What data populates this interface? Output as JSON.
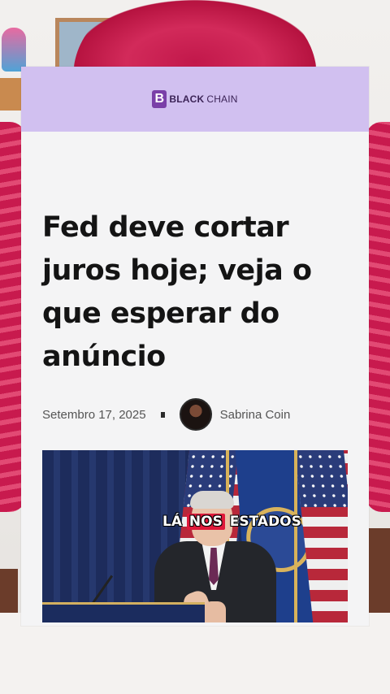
{
  "brand": {
    "mark": "B",
    "name_bold": "BLACK",
    "name_light": "CHAIN",
    "color": "#d1c0f0",
    "accent": "#7a3fa8"
  },
  "article": {
    "headline": "Fed deve cortar juros hoje; veja o que esperar do anúncio",
    "date": "Setembro 17, 2025",
    "author": "Sabrina Coin"
  },
  "caption": {
    "before": "LÁ ",
    "highlight": "NOS",
    "after": " ESTADOS",
    "highlight_color": "#e0193b"
  },
  "icons": [
    "author-avatar",
    "article-photo"
  ]
}
